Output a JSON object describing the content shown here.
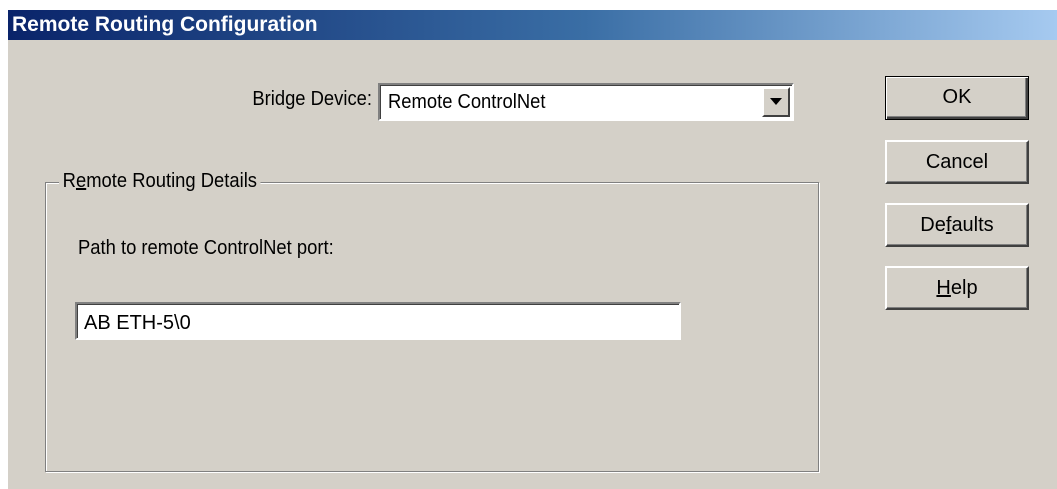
{
  "window": {
    "title": "Remote Routing Configuration"
  },
  "bridge": {
    "label": "Bridge Device:",
    "selected": "Remote ControlNet"
  },
  "group": {
    "legend_pre": "R",
    "legend_mnemonic": "e",
    "legend_post": "mote Routing Details",
    "path_label": "Path to remote ControlNet port:",
    "path_value": "AB ETH-5\\0"
  },
  "buttons": {
    "ok": "OK",
    "cancel": "Cancel",
    "defaults_pre": "De",
    "defaults_mnemonic": "f",
    "defaults_post": "aults",
    "help_mnemonic": "H",
    "help_post": "elp"
  },
  "icons": {
    "dropdown": "chevron-down-icon"
  },
  "colors": {
    "dialog_face": "#d4d0c8",
    "title_start": "#0a246a",
    "title_end": "#a6caf0"
  }
}
